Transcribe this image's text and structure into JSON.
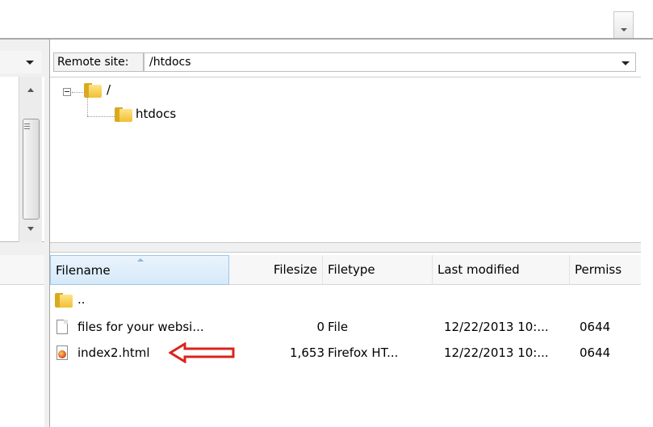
{
  "remote": {
    "label": "Remote site:",
    "path": "/htdocs"
  },
  "tree": {
    "root": "/",
    "child": "htdocs"
  },
  "columns": {
    "filename": "Filename",
    "filesize": "Filesize",
    "filetype": "Filetype",
    "last_modified": "Last modified",
    "permissions": "Permiss"
  },
  "files": [
    {
      "name": "..",
      "size": "",
      "type": "",
      "modified": "",
      "perm": "",
      "icon": "folder-icon"
    },
    {
      "name": "files for your websi...",
      "size": "0",
      "type": "File",
      "modified": "12/22/2013 10:...",
      "perm": "0644",
      "icon": "file-icon"
    },
    {
      "name": "index2.html",
      "size": "1,653",
      "type": "Firefox HT...",
      "modified": "12/22/2013 10:...",
      "perm": "0644",
      "icon": "firefox-html-icon"
    }
  ],
  "annotation": {
    "arrow_color": "#d9241c"
  }
}
